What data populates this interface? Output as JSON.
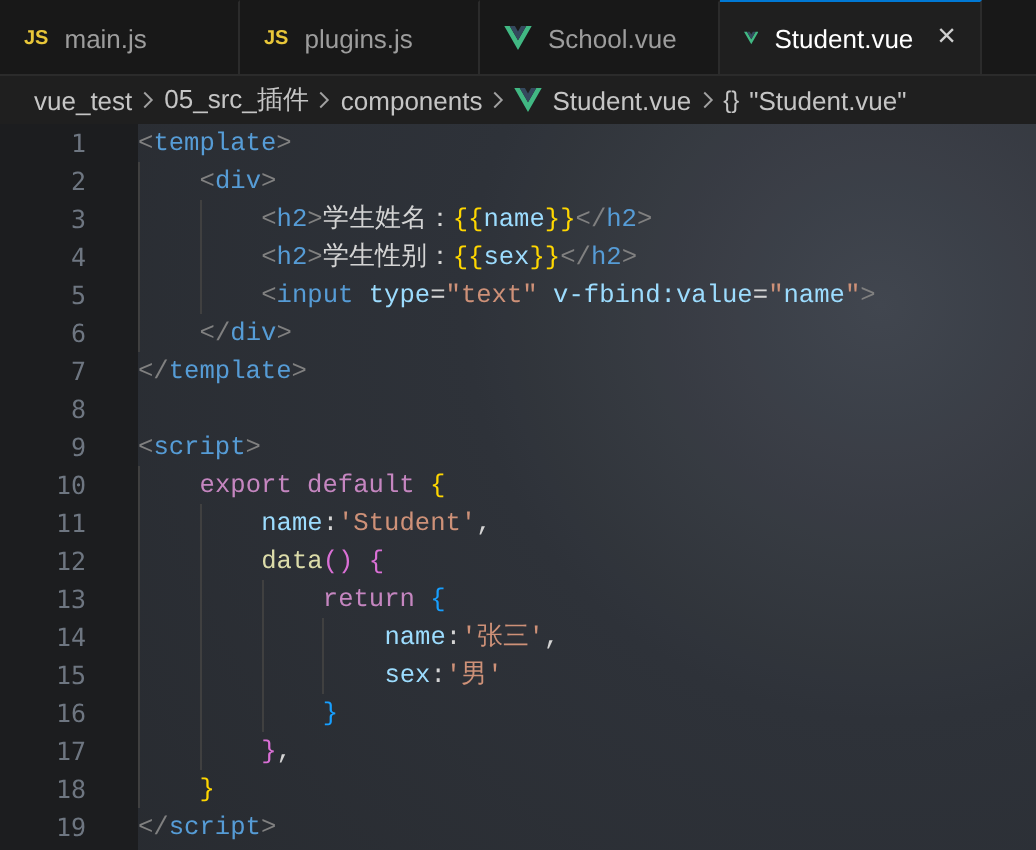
{
  "tabs": [
    {
      "label": "main.js",
      "kind": "js",
      "icon_text": "JS",
      "selected": false
    },
    {
      "label": "plugins.js",
      "kind": "js",
      "icon_text": "JS",
      "selected": false
    },
    {
      "label": "School.vue",
      "kind": "vue",
      "selected": false
    },
    {
      "label": "Student.vue",
      "kind": "vue",
      "selected": true,
      "close": "×"
    }
  ],
  "breadcrumb": [
    {
      "label": "vue_test",
      "kind": "folder"
    },
    {
      "label": "05_src_插件",
      "kind": "folder"
    },
    {
      "label": "components",
      "kind": "folder"
    },
    {
      "label": "Student.vue",
      "kind": "vue"
    },
    {
      "label": "\"Student.vue\"",
      "kind": "object",
      "icon_text": "{}"
    }
  ],
  "lines": [
    {
      "number": "1",
      "tokens": [
        {
          "kind": "punct",
          "text": "<"
        },
        {
          "kind": "tag",
          "text": "template"
        },
        {
          "kind": "punct",
          "text": ">"
        }
      ],
      "children": [
        {
          "number": "2",
          "tokens": [
            {
              "kind": "punct",
              "text": "<"
            },
            {
              "kind": "tag",
              "text": "div"
            },
            {
              "kind": "punct",
              "text": ">"
            }
          ],
          "children": [
            {
              "number": "3",
              "tokens": [
                {
                  "kind": "punct",
                  "text": "<"
                },
                {
                  "kind": "tag",
                  "text": "h2"
                },
                {
                  "kind": "punct",
                  "text": ">"
                },
                {
                  "kind": "text",
                  "text": "学生姓名："
                },
                {
                  "kind": "brace",
                  "text": "{{"
                },
                {
                  "kind": "attr",
                  "text": "name"
                },
                {
                  "kind": "brace",
                  "text": "}}"
                },
                {
                  "kind": "punct",
                  "text": "</"
                },
                {
                  "kind": "tag",
                  "text": "h2"
                },
                {
                  "kind": "punct",
                  "text": ">"
                }
              ]
            },
            {
              "number": "4",
              "tokens": [
                {
                  "kind": "punct",
                  "text": "<"
                },
                {
                  "kind": "tag",
                  "text": "h2"
                },
                {
                  "kind": "punct",
                  "text": ">"
                },
                {
                  "kind": "text",
                  "text": "学生性别："
                },
                {
                  "kind": "brace",
                  "text": "{{"
                },
                {
                  "kind": "attr",
                  "text": "sex"
                },
                {
                  "kind": "brace",
                  "text": "}}"
                },
                {
                  "kind": "punct",
                  "text": "</"
                },
                {
                  "kind": "tag",
                  "text": "h2"
                },
                {
                  "kind": "punct",
                  "text": ">"
                }
              ]
            },
            {
              "number": "5",
              "tokens": [
                {
                  "kind": "punct",
                  "text": "<"
                },
                {
                  "kind": "tag",
                  "text": "input "
                },
                {
                  "kind": "attr",
                  "text": "type"
                },
                {
                  "kind": "text",
                  "text": "="
                },
                {
                  "kind": "string",
                  "text": "\"text\" "
                },
                {
                  "kind": "attr",
                  "text": "v-fbind:value"
                },
                {
                  "kind": "text",
                  "text": "="
                },
                {
                  "kind": "string",
                  "text": "\""
                },
                {
                  "kind": "attr",
                  "text": "name"
                },
                {
                  "kind": "string",
                  "text": "\""
                },
                {
                  "kind": "punct",
                  "text": ">"
                }
              ]
            }
          ]
        },
        {
          "number": "6",
          "tokens": [
            {
              "kind": "punct",
              "text": "</"
            },
            {
              "kind": "tag",
              "text": "div"
            },
            {
              "kind": "punct",
              "text": ">"
            }
          ]
        }
      ]
    },
    {
      "number": "7",
      "tokens": [
        {
          "kind": "punct",
          "text": "</"
        },
        {
          "kind": "tag",
          "text": "template"
        },
        {
          "kind": "punct",
          "text": ">"
        }
      ]
    },
    {
      "number": "8"
    },
    {
      "number": "9",
      "tokens": [
        {
          "kind": "punct",
          "text": "<"
        },
        {
          "kind": "tag",
          "text": "script"
        },
        {
          "kind": "punct",
          "text": ">"
        }
      ],
      "children": [
        {
          "number": "10",
          "tokens": [
            {
              "kind": "keyword",
              "text": "export default "
            },
            {
              "kind": "brace",
              "text": "{"
            }
          ],
          "children": [
            {
              "number": "11",
              "tokens": [
                {
                  "kind": "attr",
                  "text": "name"
                },
                {
                  "kind": "text",
                  "text": ":"
                },
                {
                  "kind": "string",
                  "text": "'Student'"
                },
                {
                  "kind": "text",
                  "text": ","
                }
              ]
            },
            {
              "number": "12",
              "tokens": [
                {
                  "kind": "func",
                  "text": "data"
                },
                {
                  "kind": "paren",
                  "text": "() {"
                }
              ],
              "children": [
                {
                  "number": "13",
                  "tokens": [
                    {
                      "kind": "keyword",
                      "text": "return "
                    },
                    {
                      "kind": "bracket",
                      "text": "{"
                    }
                  ],
                  "children": [
                    {
                      "number": "14",
                      "tokens": [
                        {
                          "kind": "attr",
                          "text": "name"
                        },
                        {
                          "kind": "text",
                          "text": ":"
                        },
                        {
                          "kind": "string",
                          "text": "'张三'"
                        },
                        {
                          "kind": "text",
                          "text": ","
                        }
                      ]
                    },
                    {
                      "number": "15",
                      "tokens": [
                        {
                          "kind": "attr",
                          "text": "sex"
                        },
                        {
                          "kind": "text",
                          "text": ":"
                        },
                        {
                          "kind": "string",
                          "text": "'男'"
                        }
                      ]
                    }
                  ]
                },
                {
                  "number": "16",
                  "tokens": [
                    {
                      "kind": "bracket",
                      "text": "}"
                    }
                  ]
                }
              ]
            },
            {
              "number": "17",
              "tokens": [
                {
                  "kind": "paren",
                  "text": "}"
                },
                {
                  "kind": "text",
                  "text": ","
                }
              ]
            }
          ]
        },
        {
          "number": "18",
          "tokens": [
            {
              "kind": "brace",
              "text": "}"
            }
          ]
        }
      ]
    },
    {
      "number": "19",
      "tokens": [
        {
          "kind": "punct",
          "text": "</"
        },
        {
          "kind": "tag",
          "text": "script"
        },
        {
          "kind": "punct",
          "text": ">"
        }
      ]
    }
  ]
}
